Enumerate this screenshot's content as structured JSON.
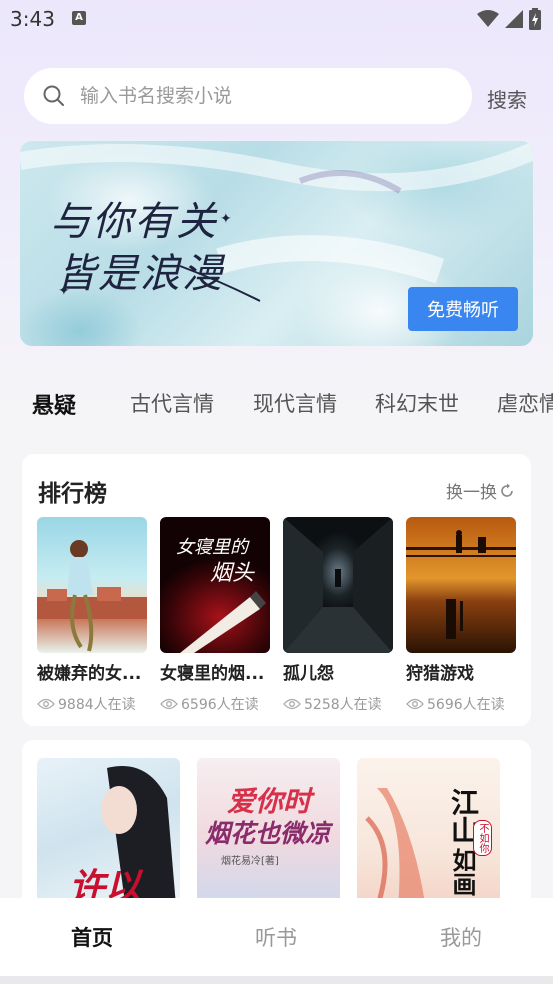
{
  "status_bar": {
    "time": "3:43",
    "notification_icon": "a-icon",
    "wifi_icon": "wifi-icon",
    "signal_icon": "signal-icon",
    "battery_icon": "battery-charging-icon"
  },
  "search": {
    "placeholder": "输入书名搜索小说",
    "button_label": "搜索"
  },
  "banner": {
    "line1": "与你有关",
    "line2": "皆是浪漫",
    "button_label": "免费畅听"
  },
  "categories": [
    "悬疑",
    "古代言情",
    "现代言情",
    "科幻末世",
    "虐恋情"
  ],
  "active_category": "悬疑",
  "ranking": {
    "title": "排行榜",
    "refresh_label": "换一换",
    "books": [
      {
        "title": "被嫌弃的女...",
        "readers": "9884人在读"
      },
      {
        "title": "女寝里的烟...",
        "readers": "6596人在读",
        "cover_text_1": "女寝里的",
        "cover_text_2": "烟头"
      },
      {
        "title": "孤儿怨",
        "readers": "5258人在读"
      },
      {
        "title": "狩猎游戏",
        "readers": "5696人在读"
      }
    ]
  },
  "second_section": {
    "books": [
      {
        "cover_text": "许以"
      },
      {
        "cover_text_1": "爱你时",
        "cover_text_2": "烟花也微凉",
        "cover_author": "烟花易冷[著]"
      },
      {
        "cover_text_1": "江山",
        "cover_text_2": "如画",
        "cover_badge": "不如你"
      }
    ]
  },
  "bottom_nav": {
    "items": [
      "首页",
      "听书",
      "我的"
    ],
    "active": "首页"
  },
  "colors": {
    "accent_blue": "#3a86f0",
    "text_dark": "#222222",
    "text_muted": "#999999"
  }
}
